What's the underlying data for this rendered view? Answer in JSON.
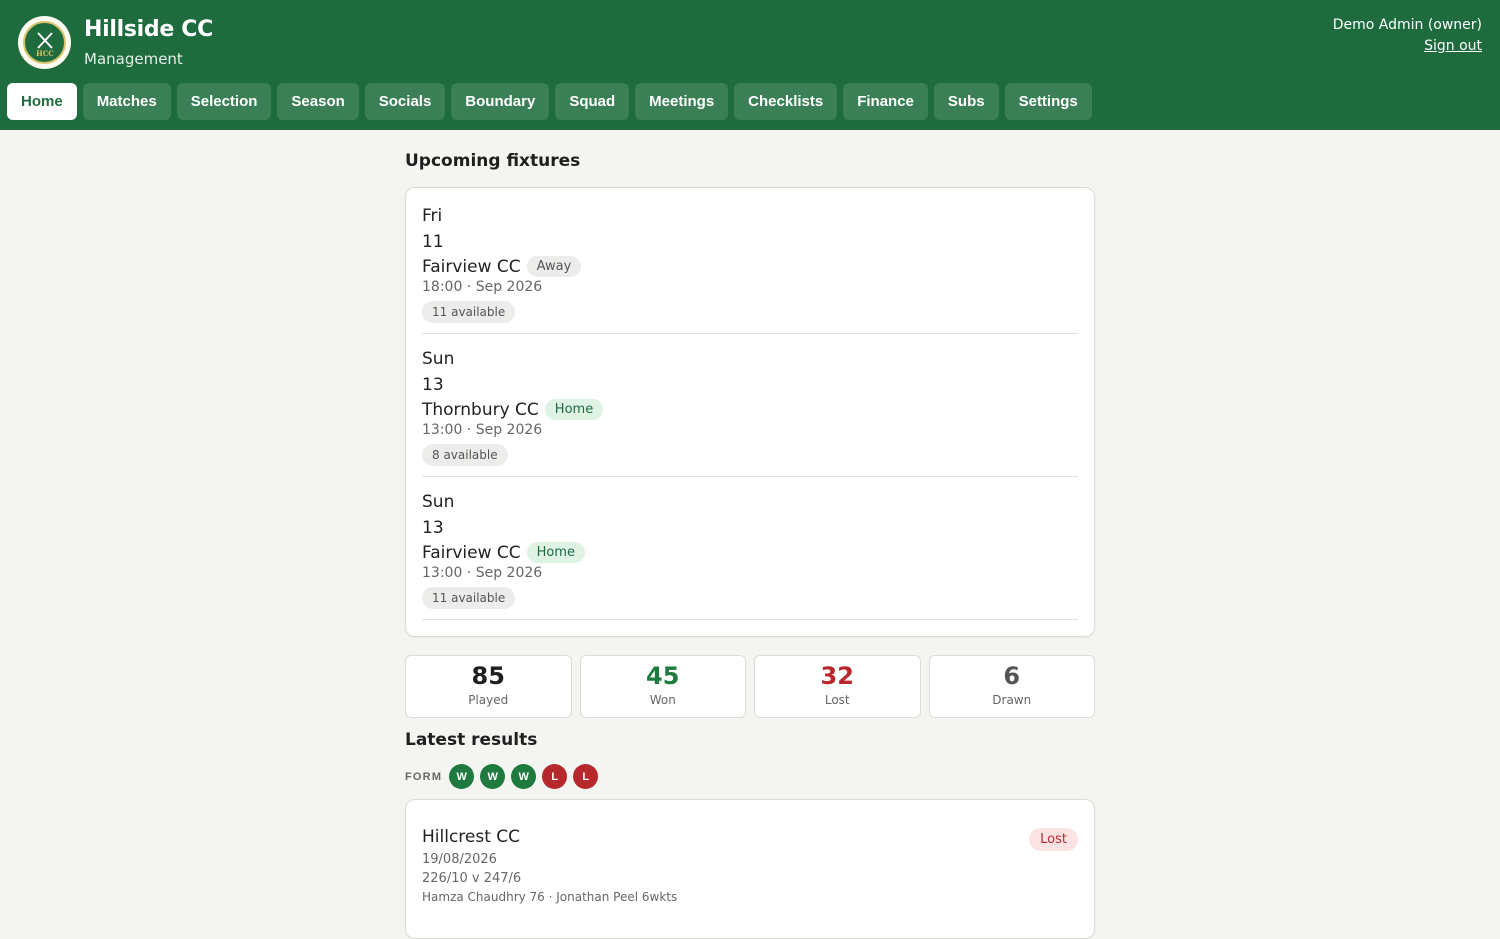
{
  "app": {
    "title": "Hillside CC",
    "subtitle": "Management",
    "logo_text": "HCC"
  },
  "user": {
    "display": "Demo Admin (owner)",
    "signout": "Sign out"
  },
  "nav": {
    "tabs": [
      {
        "label": "Home",
        "active": true
      },
      {
        "label": "Matches"
      },
      {
        "label": "Selection"
      },
      {
        "label": "Season"
      },
      {
        "label": "Socials"
      },
      {
        "label": "Boundary"
      },
      {
        "label": "Squad"
      },
      {
        "label": "Meetings"
      },
      {
        "label": "Checklists"
      },
      {
        "label": "Finance"
      },
      {
        "label": "Subs"
      },
      {
        "label": "Settings"
      }
    ]
  },
  "fixtures": {
    "title": "Upcoming fixtures",
    "items": [
      {
        "day": "Fri",
        "date": "11",
        "opponent": "Fairview CC",
        "venue": "Away",
        "time": "18:00 · Sep 2026",
        "available": "11 available"
      },
      {
        "day": "Sun",
        "date": "13",
        "opponent": "Thornbury CC",
        "venue": "Home",
        "time": "13:00 · Sep 2026",
        "available": "8 available"
      },
      {
        "day": "Sun",
        "date": "13",
        "opponent": "Fairview CC",
        "venue": "Home",
        "time": "13:00 · Sep 2026",
        "available": "11 available"
      }
    ]
  },
  "stats": {
    "played": {
      "value": "85",
      "label": "Played"
    },
    "won": {
      "value": "45",
      "label": "Won"
    },
    "lost": {
      "value": "32",
      "label": "Lost"
    },
    "drawn": {
      "value": "6",
      "label": "Drawn"
    }
  },
  "results": {
    "title": "Latest results",
    "form_label": "FORM",
    "form": [
      "W",
      "W",
      "W",
      "L",
      "L"
    ],
    "latest": {
      "opponent": "Hillcrest CC",
      "date": "19/08/2026",
      "score": "226/10 v 247/6",
      "performers": "Hamza Chaudhry 76 · Jonathan Peel 6wkts",
      "outcome": "Lost"
    }
  },
  "colors": {
    "brand": "#1e6b3e",
    "won": "#1e7a3e",
    "lost": "#b7282c",
    "drawn": "#555555"
  }
}
